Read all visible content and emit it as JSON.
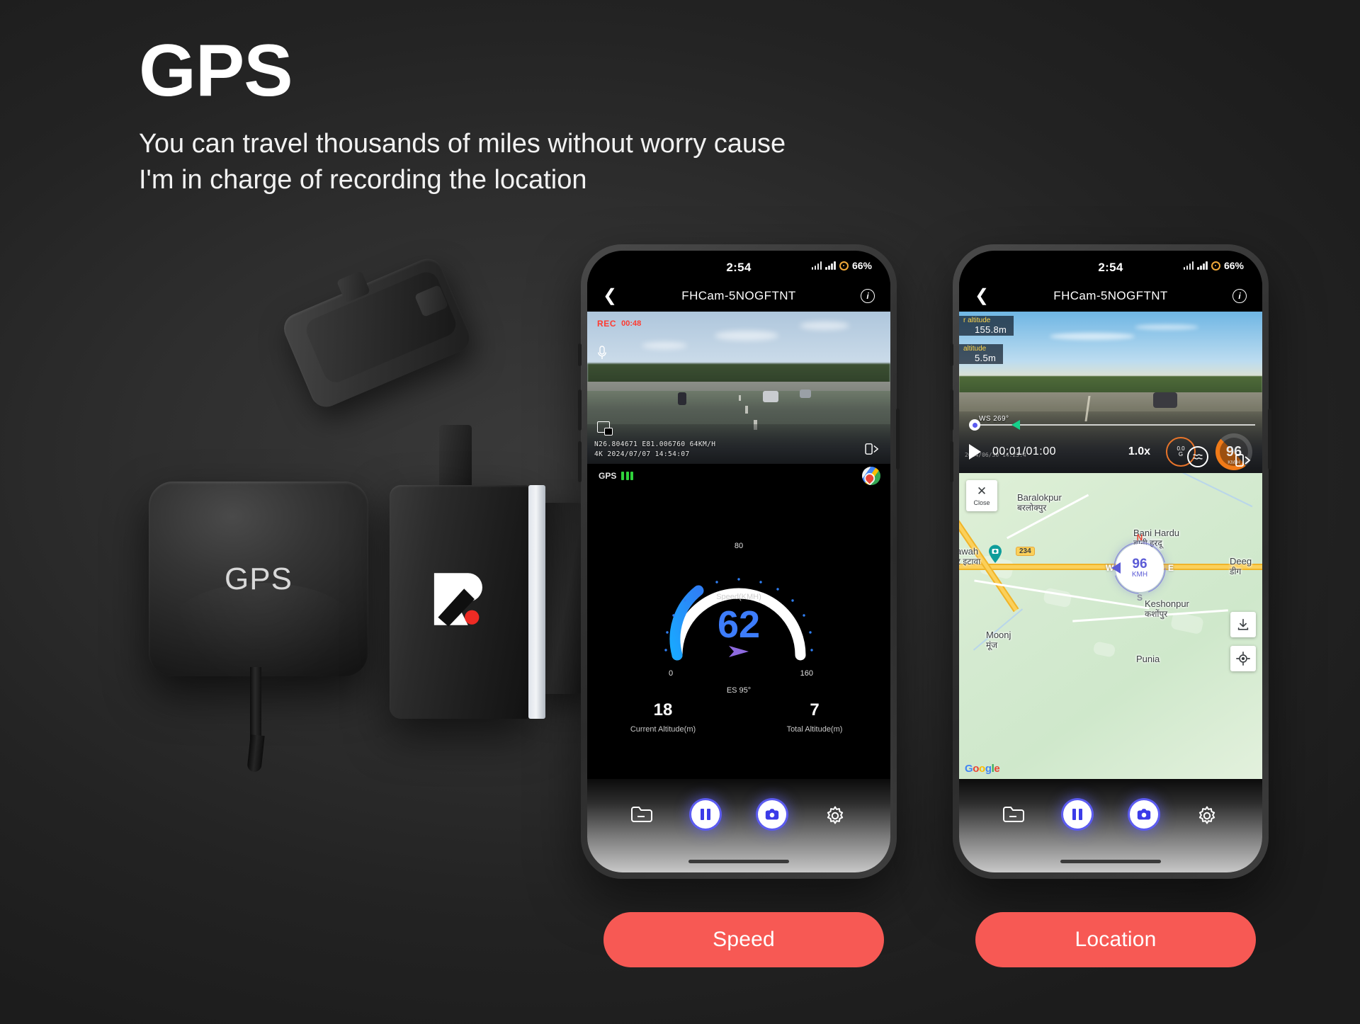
{
  "headline": {
    "title": "GPS",
    "subtitle": "You can travel thousands of miles without worry cause\nI'm in charge of recording the location"
  },
  "hardware": {
    "gps_module_label": "GPS",
    "dashcam_logo": "R"
  },
  "phone1": {
    "statusbar": {
      "time": "2:54",
      "battery": "66%"
    },
    "titlebar": {
      "back_icon": "chevron-left-icon",
      "title": "FHCam-5NOGFTNT",
      "info_icon": "info-icon"
    },
    "video": {
      "rec_label": "REC",
      "rec_time": "00:48",
      "osd_line1": "N26.804671 E81.006760 64KM/H",
      "osd_line2": "4K 2024/07/07 14:54:07"
    },
    "gps_row": {
      "label": "GPS",
      "bars": 3,
      "map_icon": "google-maps-pin-icon"
    },
    "gauge": {
      "unit_label": "Speed(KMH)",
      "value": "62",
      "min": "0",
      "max": "160",
      "top": "80",
      "direction": "ES 95°"
    },
    "stats": [
      {
        "value": "18",
        "label": "Current Altitude(m)"
      },
      {
        "value": "7",
        "label": "Total Altitude(m)"
      }
    ],
    "toolbar": {
      "folder_icon": "folder-icon",
      "pause_icon": "pause-icon",
      "capture_icon": "camera-icon",
      "settings_icon": "gear-icon"
    }
  },
  "phone2": {
    "statusbar": {
      "time": "2:54",
      "battery": "66%"
    },
    "titlebar": {
      "back_icon": "chevron-left-icon",
      "title": "FHCam-5NOGFTNT",
      "info_icon": "info-icon"
    },
    "video": {
      "alt_label_1": "r altitude",
      "alt_value_1": "155.8m",
      "alt_label_2": "altitude",
      "alt_value_2": "5.5m",
      "heading": "WS 269°",
      "osd_line1": "2024/06/30  14:23:4"
    },
    "player": {
      "play_icon": "play-icon",
      "timecode": "00:01/01:00",
      "rate": "1.0x",
      "g_value": "0.0",
      "g_unit": "G",
      "wave_icon": "stabilizer-icon",
      "speed_value": "96",
      "speed_unit": "KM/H",
      "rotate_icon": "rotate-screen-icon"
    },
    "map": {
      "close_label": "Close",
      "close_icon": "close-icon",
      "watermark": "Google",
      "download_icon": "download-icon",
      "locate_icon": "my-location-icon",
      "compass": {
        "north": "N",
        "east": "E",
        "south": "S",
        "west": "W",
        "speed": "96",
        "unit": "KMH"
      },
      "highway_shield": "234",
      "labels": [
        {
          "en": "Baralokpur",
          "hi": "बरलोक्पुर"
        },
        {
          "en": "Bani Hardu",
          "hi": "बानी हरदू"
        },
        {
          "en": "Deeg",
          "hi": "डीग"
        },
        {
          "en": "Keshonpur",
          "hi": "कशोंपुर"
        },
        {
          "en": "Moonj",
          "hi": "मूंज"
        },
        {
          "en": "Punia",
          "hi": ""
        },
        {
          "en": "awah",
          "hi": "ट इटावा"
        }
      ]
    },
    "toolbar": {
      "folder_icon": "folder-icon",
      "pause_icon": "pause-icon",
      "capture_icon": "camera-icon",
      "settings_icon": "gear-icon"
    }
  },
  "cta": {
    "speed": "Speed",
    "location": "Location"
  },
  "colors": {
    "accent": "#f75954",
    "gauge": "#3d7dfc",
    "gps_signal": "#2fd23b",
    "background": "#2b2b2b"
  }
}
